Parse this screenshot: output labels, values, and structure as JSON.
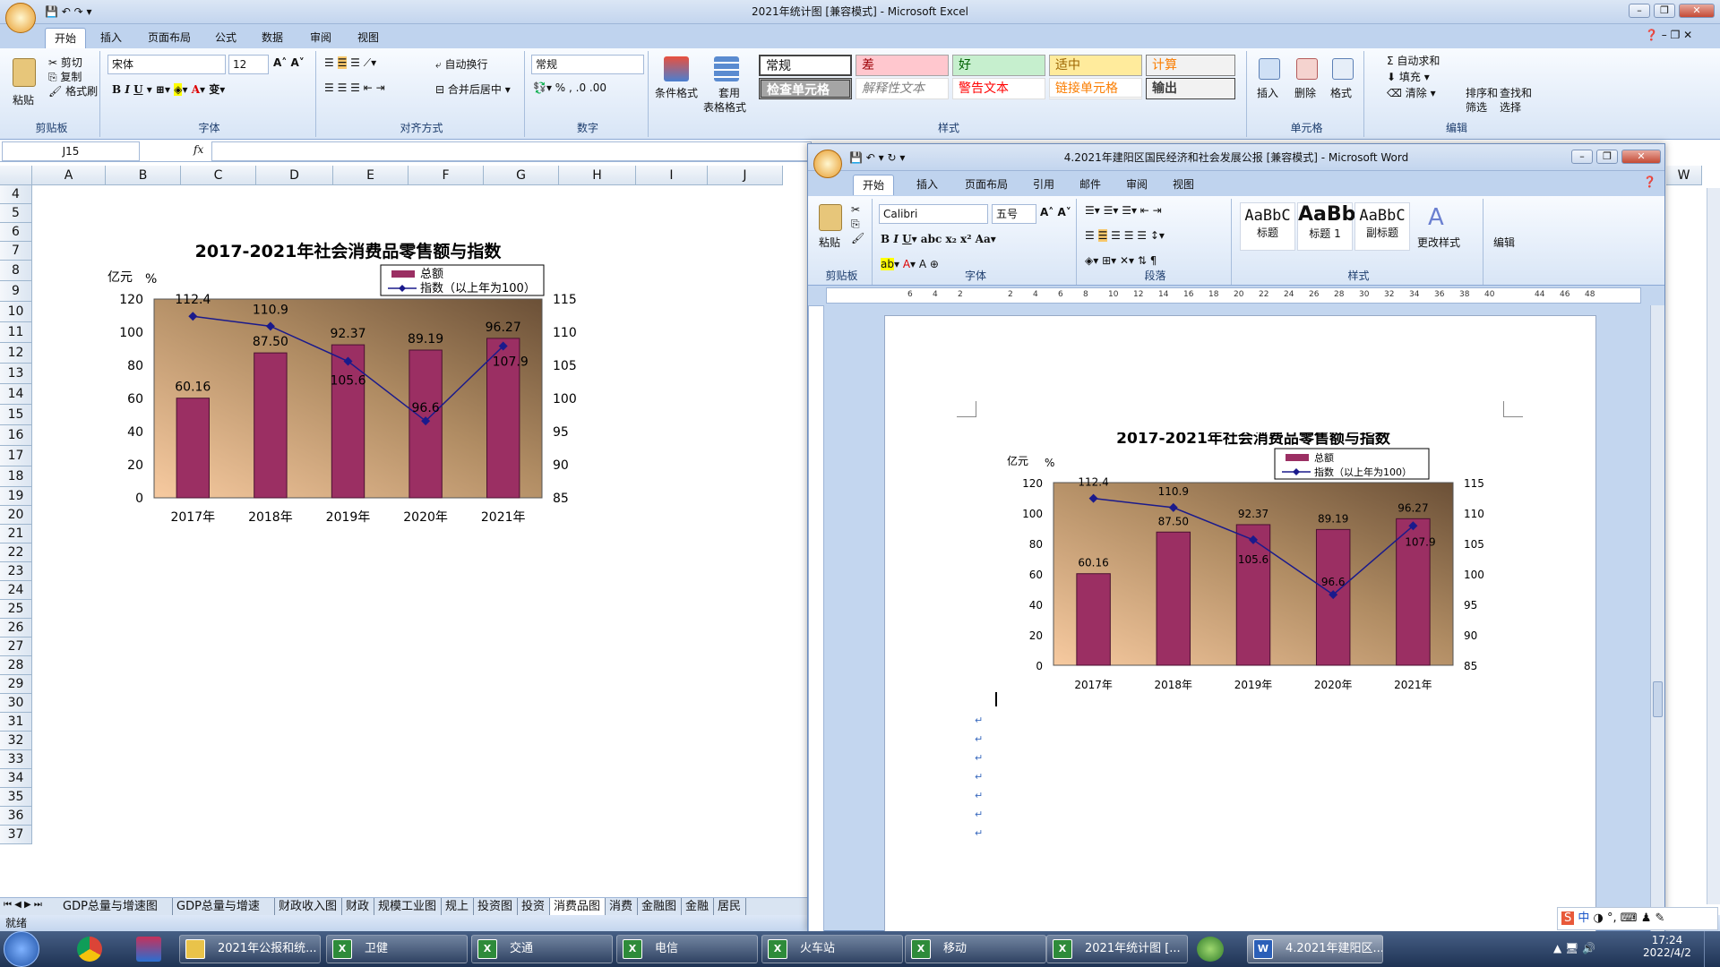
{
  "excel": {
    "title": "2021年统计图 [兼容模式] - Microsoft Excel",
    "tabs": [
      "开始",
      "插入",
      "页面布局",
      "公式",
      "数据",
      "审阅",
      "视图"
    ],
    "clipboard": {
      "paste": "粘贴",
      "cut": "剪切",
      "copy": "复制",
      "painter": "格式刷",
      "group": "剪贴板"
    },
    "font": {
      "name": "宋体",
      "size": "12",
      "group": "字体"
    },
    "align": {
      "wrap": "自动换行",
      "merge": "合并后居中",
      "group": "对齐方式"
    },
    "number": {
      "format": "常规",
      "group": "数字"
    },
    "styles": {
      "cond": "条件格式",
      "table": "套用",
      "table2": "表格格式",
      "cells": [
        "常规",
        "差",
        "好",
        "适中",
        "计算",
        "检查单元格",
        "解释性文本",
        "警告文本",
        "链接单元格",
        "输出"
      ],
      "group": "样式"
    },
    "cellgrp": {
      "insert": "插入",
      "delete": "删除",
      "format": "格式",
      "group": "单元格"
    },
    "edit": {
      "autosum": "Σ 自动求和",
      "fill": "填充",
      "clear": "清除",
      "sort": "排序和",
      "sort2": "筛选",
      "find": "查找和",
      "find2": "选择",
      "group": "编辑"
    },
    "namebox": "J15",
    "fx": "fx",
    "columns": [
      "A",
      "B",
      "C",
      "D",
      "E",
      "F",
      "G",
      "H",
      "I",
      "J"
    ],
    "rows": [
      "4",
      "5",
      "6",
      "7",
      "8",
      "9",
      "10",
      "11",
      "12",
      "13",
      "14",
      "15",
      "16",
      "17",
      "18",
      "19",
      "20",
      "21",
      "22",
      "23",
      "24",
      "25",
      "26",
      "27",
      "28",
      "29",
      "30",
      "31",
      "32",
      "33",
      "34",
      "35",
      "36",
      "37"
    ],
    "sheets": [
      "GDP总量与增速图",
      "GDP总量与增速",
      "财政收入图",
      "财政",
      "规模工业图",
      "规上",
      "投资图",
      "投资",
      "消费品图",
      "消费",
      "金融图",
      "金融",
      "居民"
    ],
    "status": "就绪",
    "extra_col": "W"
  },
  "word": {
    "title": "4.2021年建阳区国民经济和社会发展公报 [兼容模式] - Microsoft Word",
    "tabs": [
      "开始",
      "插入",
      "页面布局",
      "引用",
      "邮件",
      "审阅",
      "视图"
    ],
    "paste": "粘贴",
    "clipboard_group": "剪贴板",
    "font": {
      "name": "Calibri",
      "size": "五号",
      "group": "字体"
    },
    "para_group": "段落",
    "styles": [
      {
        "preview": "AaBbC",
        "name": "标题"
      },
      {
        "preview": "AaBb",
        "name": "标题 1"
      },
      {
        "preview": "AaBbC",
        "name": "副标题"
      }
    ],
    "change_styles": "更改样式",
    "edit": "编辑",
    "styles_group": "样式",
    "ruler_marks": [
      "6",
      "4",
      "2",
      "",
      "2",
      "4",
      "6",
      "8",
      "10",
      "12",
      "14",
      "16",
      "18",
      "20",
      "22",
      "24",
      "26",
      "28",
      "30",
      "32",
      "34",
      "36",
      "38",
      "40",
      "",
      "44",
      "46",
      "48"
    ]
  },
  "chart_data": {
    "type": "bar",
    "title": "2017-2021年社会消费品零售额与指数",
    "categories": [
      "2017年",
      "2018年",
      "2019年",
      "2020年",
      "2021年"
    ],
    "ylabel_left": "亿元",
    "ylabel_right": "%",
    "ylim_left": [
      0,
      120
    ],
    "yticks_left": [
      "0",
      "20",
      "40",
      "60",
      "80",
      "100",
      "120"
    ],
    "ylim_right": [
      85,
      115
    ],
    "yticks_right": [
      "85",
      "90",
      "95",
      "100",
      "105",
      "110",
      "115"
    ],
    "series": [
      {
        "name": "总额",
        "type": "bar",
        "axis": "left",
        "values": [
          60.16,
          87.5,
          92.37,
          89.19,
          96.27
        ],
        "labels": [
          "60.16",
          "87.50",
          "92.37",
          "89.19",
          "96.27"
        ]
      },
      {
        "name": "指数（以上年为100）",
        "type": "line",
        "axis": "right",
        "values": [
          112.4,
          110.9,
          105.6,
          96.6,
          107.9
        ],
        "labels": [
          "112.4",
          "110.9",
          "105.6",
          "96.6",
          "107.9"
        ]
      }
    ],
    "legend": "top-right",
    "colors": {
      "bar": "#9b2f63",
      "line": "#1a1a8c"
    }
  },
  "taskbar": {
    "items": [
      "2021年公报和统...",
      "卫健",
      "交通",
      "电信",
      "火车站",
      "移动",
      "2021年统计图 [...",
      "",
      "4.2021年建阳区..."
    ],
    "time": "17:24",
    "date": "2022/4/2",
    "ime": "中"
  }
}
